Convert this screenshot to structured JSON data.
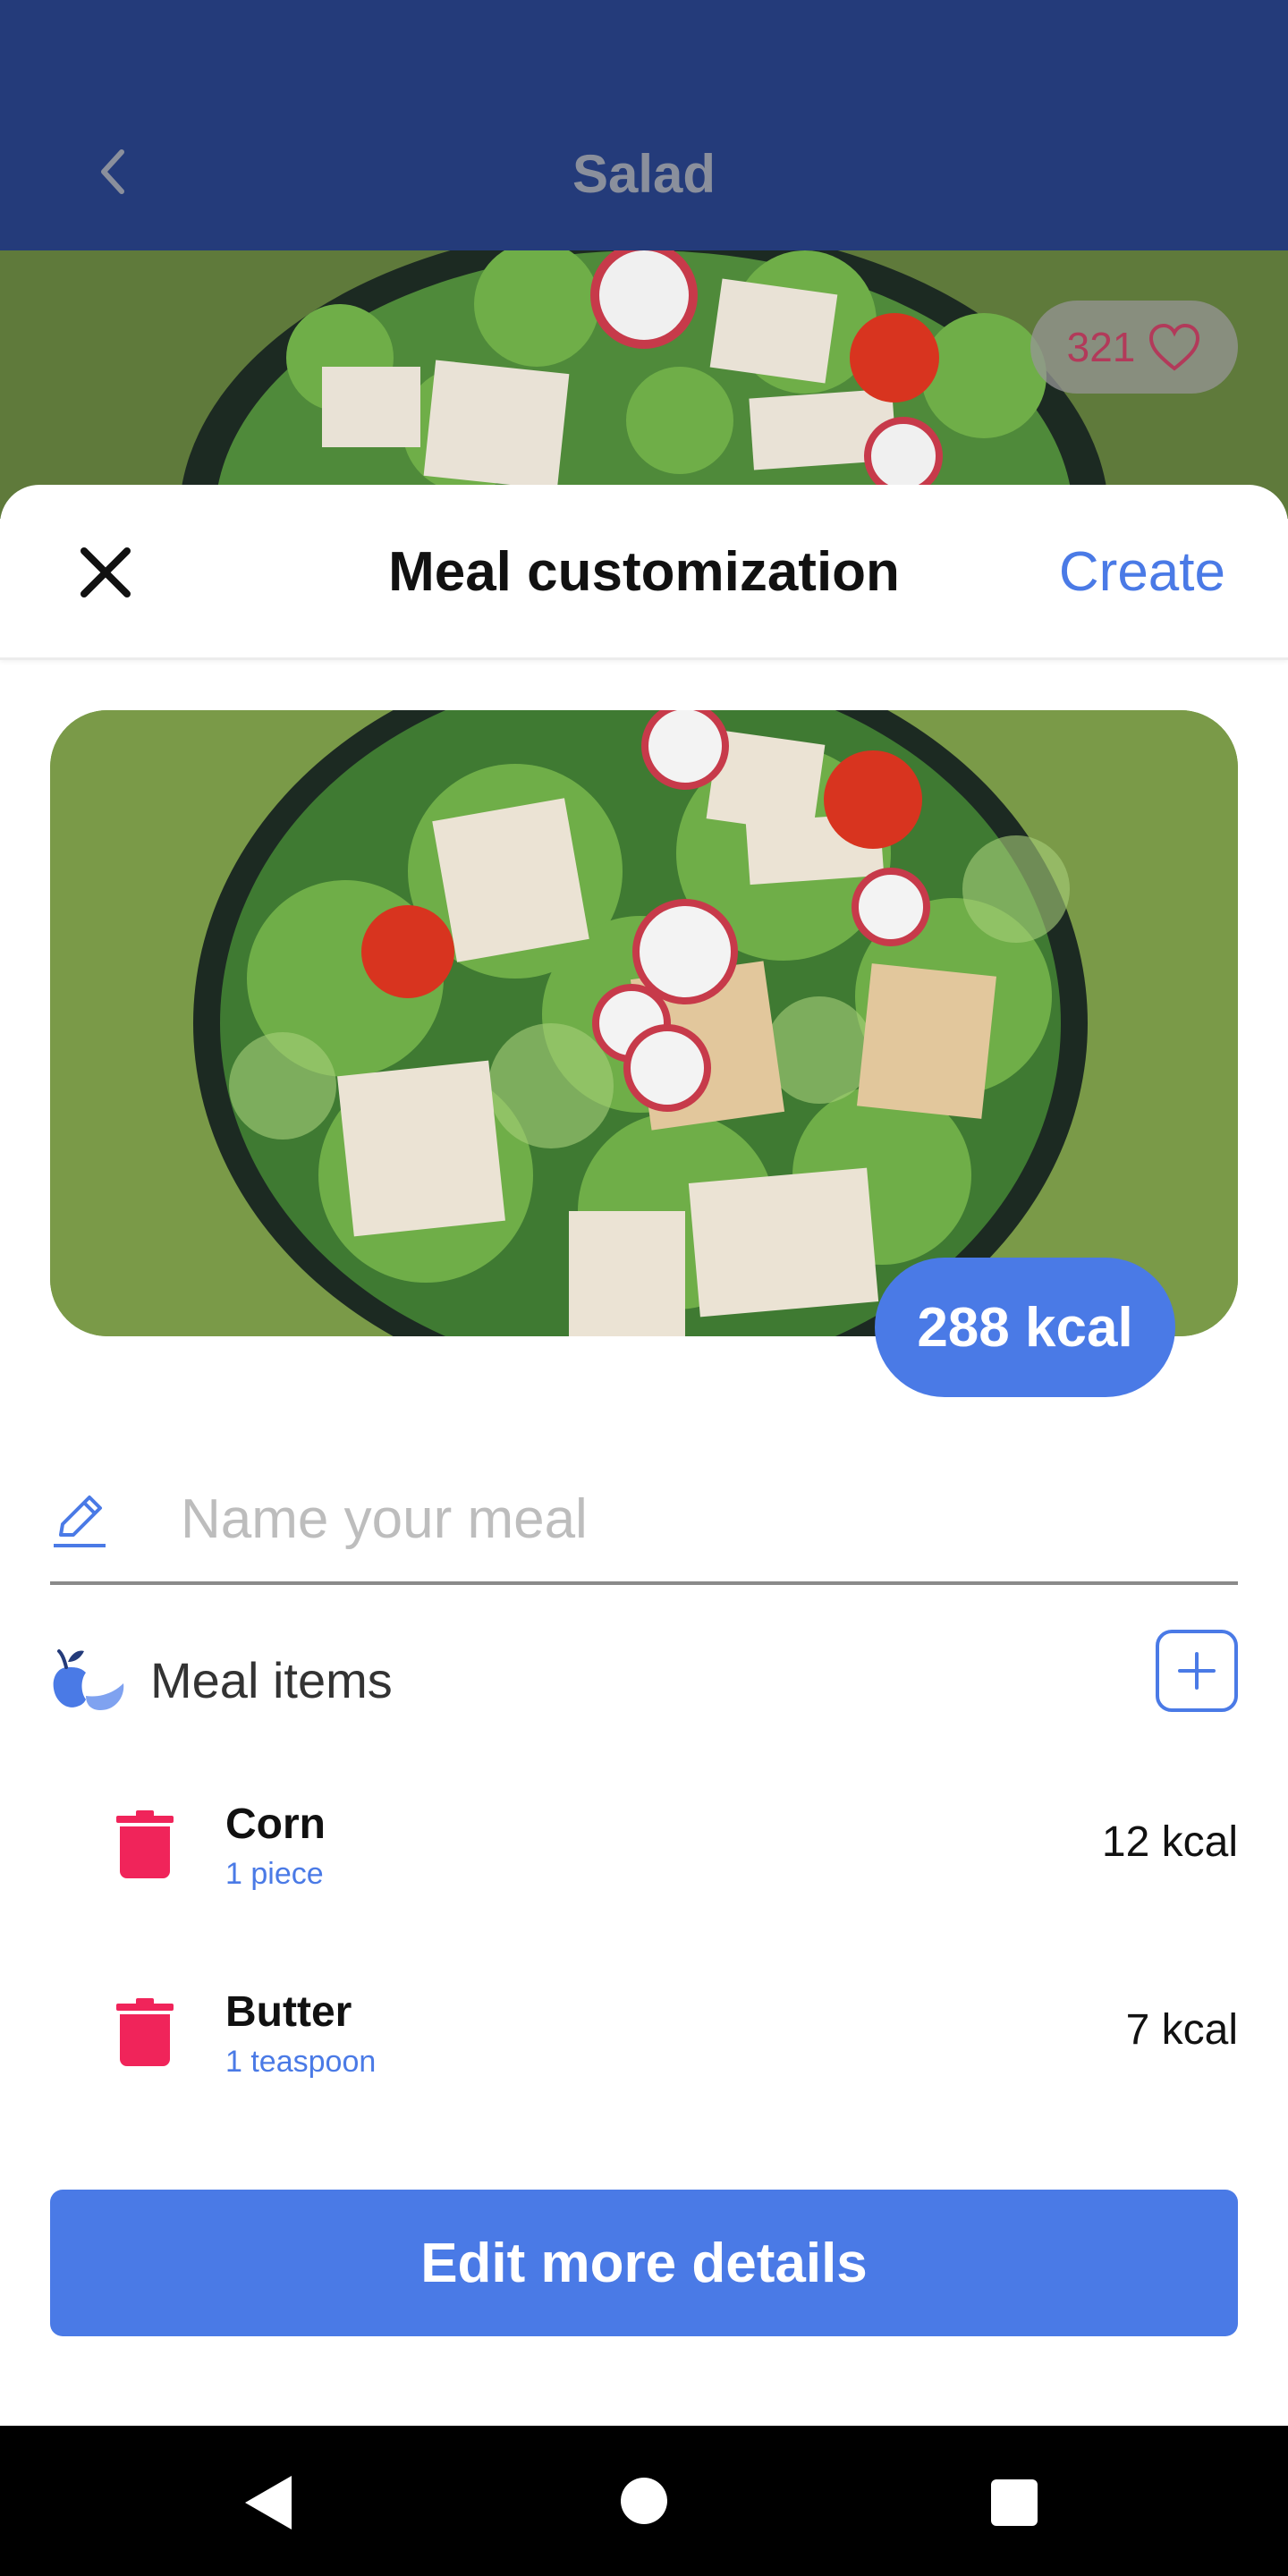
{
  "app_bar": {
    "title": "Salad"
  },
  "hero": {
    "likes": "321"
  },
  "sheet": {
    "title": "Meal customization",
    "create_label": "Create",
    "kcal_total": "288 kcal",
    "name_placeholder": "Name your meal",
    "name_value": "",
    "items_title": "Meal items",
    "items": [
      {
        "name": "Corn",
        "amount": "1 piece",
        "kcal": "12 kcal"
      },
      {
        "name": "Butter",
        "amount": "1 teaspoon",
        "kcal": "7 kcal"
      }
    ],
    "edit_button_label": "Edit more details"
  },
  "icons": {
    "back": "chevron-left-icon",
    "like": "heart-icon",
    "close": "close-icon",
    "pencil": "pencil-icon",
    "fruit": "fruit-icon",
    "add": "plus-icon",
    "delete": "trash-icon"
  },
  "colors": {
    "app_bar": "#243B7A",
    "accent": "#4A7AE6",
    "delete": "#F0245A",
    "nav_bar": "#000000"
  }
}
